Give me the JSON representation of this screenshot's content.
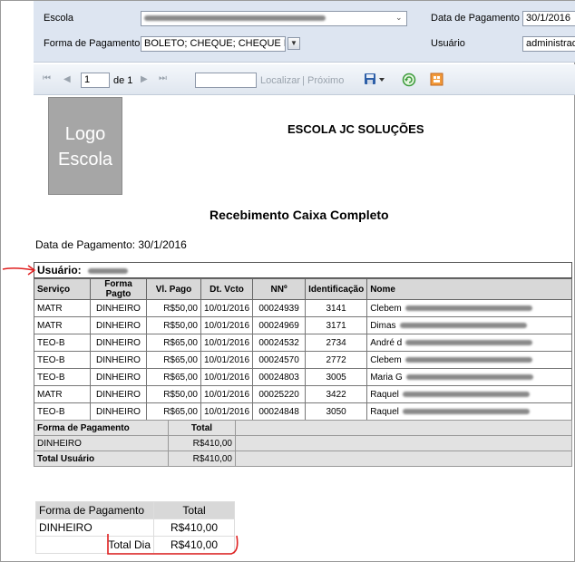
{
  "params": {
    "school_label": "Escola",
    "payment_form_label": "Forma de Pagamento",
    "payment_form_value": "BOLETO; CHEQUE; CHEQUE PRE;",
    "payment_date_label": "Data de Pagamento",
    "payment_date_value": "30/1/2016",
    "user_label": "Usuário",
    "user_value": "administrad"
  },
  "toolbar": {
    "first_page": "⏮",
    "prev_page": "◀",
    "page_value": "1",
    "page_of": "de 1",
    "next_page": "▶",
    "last_page": "⏭",
    "find_label": "Localizar",
    "separator": "|",
    "next_label": "Próximo"
  },
  "report": {
    "logo_text": "Logo Escola",
    "school_name": "ESCOLA JC SOLUÇÕES",
    "title": "Recebimento Caixa Completo",
    "payment_date_line": "Data de Pagamento: 30/1/2016",
    "user_line": "Usuário:",
    "columns": [
      "Serviço",
      "Forma Pagto",
      "Vl. Pago",
      "Dt. Vcto",
      "NNº",
      "Identificação",
      "Nome"
    ],
    "rows": [
      {
        "servico": "MATR",
        "forma": "DINHEIRO",
        "valor": "R$50,00",
        "vcto": "10/01/2016",
        "nn": "00024939",
        "id": "3141",
        "nome": "Clebem"
      },
      {
        "servico": "MATR",
        "forma": "DINHEIRO",
        "valor": "R$50,00",
        "vcto": "10/01/2016",
        "nn": "00024969",
        "id": "3171",
        "nome": "Dimas"
      },
      {
        "servico": "TEO-B",
        "forma": "DINHEIRO",
        "valor": "R$65,00",
        "vcto": "10/01/2016",
        "nn": "00024532",
        "id": "2734",
        "nome": "André d"
      },
      {
        "servico": "TEO-B",
        "forma": "DINHEIRO",
        "valor": "R$65,00",
        "vcto": "10/01/2016",
        "nn": "00024570",
        "id": "2772",
        "nome": "Clebem"
      },
      {
        "servico": "TEO-B",
        "forma": "DINHEIRO",
        "valor": "R$65,00",
        "vcto": "10/01/2016",
        "nn": "00024803",
        "id": "3005",
        "nome": "Maria G"
      },
      {
        "servico": "MATR",
        "forma": "DINHEIRO",
        "valor": "R$50,00",
        "vcto": "10/01/2016",
        "nn": "00025220",
        "id": "3422",
        "nome": "Raquel"
      },
      {
        "servico": "TEO-B",
        "forma": "DINHEIRO",
        "valor": "R$65,00",
        "vcto": "10/01/2016",
        "nn": "00024848",
        "id": "3050",
        "nome": "Raquel"
      }
    ],
    "subtotal": {
      "col_form": "Forma de Pagamento",
      "col_total": "Total",
      "form": "DINHEIRO",
      "value": "R$410,00",
      "user_total_label": "Total Usuário",
      "user_total_value": "R$410,00"
    },
    "summary": {
      "col_form": "Forma de Pagamento",
      "col_total": "Total",
      "form": "DINHEIRO",
      "value": "R$410,00",
      "day_label": "Total Dia",
      "day_value": "R$410,00"
    }
  },
  "colors": {
    "params_bg": "#dde5f1",
    "header_bg": "#d8d8d8",
    "annotation_red": "#e02020"
  }
}
